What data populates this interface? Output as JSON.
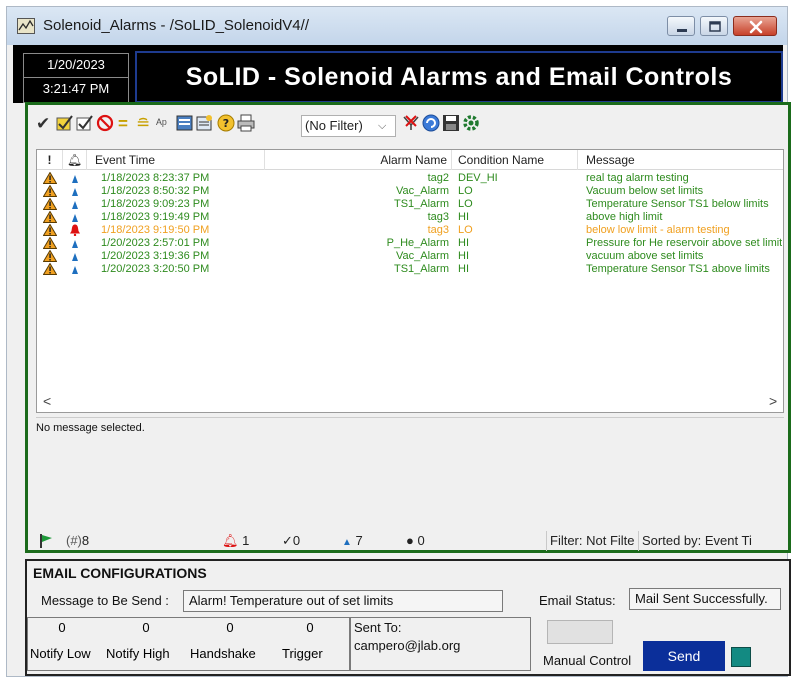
{
  "window": {
    "title": "Solenoid_Alarms - /SoLID_SolenoidV4//"
  },
  "header": {
    "date": "1/20/2023",
    "time": "3:21:47 PM",
    "banner": "SoLID - Solenoid Alarms and Email Controls"
  },
  "toolbar": {
    "filter_value": "(No Filter)",
    "icons": [
      "acknowledge-icon",
      "ack-all-icon",
      "ack-visible-icon",
      "disable-icon",
      "equals-icon",
      "sort-icon",
      "tag-icon",
      "details-icon",
      "settings-icon",
      "help-icon",
      "print-icon",
      "filter-clear-icon",
      "refresh-icon",
      "save-icon",
      "gear-icon"
    ]
  },
  "grid": {
    "columns": [
      "!",
      "",
      "Event Time",
      "Alarm Name",
      "Condition Name",
      "Message"
    ],
    "rows": [
      {
        "time": "1/18/2023 8:23:37 PM",
        "alarm": "tag2",
        "condition": "DEV_HI",
        "message": "real tag alarm testing",
        "state": "normal"
      },
      {
        "time": "1/18/2023 8:50:32 PM",
        "alarm": "Vac_Alarm",
        "condition": "LO",
        "message": "Vacuum below set limits",
        "state": "normal"
      },
      {
        "time": "1/18/2023 9:09:23 PM",
        "alarm": "TS1_Alarm",
        "condition": "LO",
        "message": "Temperature Sensor TS1 below limits",
        "state": "normal"
      },
      {
        "time": "1/18/2023 9:19:49 PM",
        "alarm": "tag3",
        "condition": "HI",
        "message": "above high limit",
        "state": "normal"
      },
      {
        "time": "1/18/2023 9:19:50 PM",
        "alarm": "tag3",
        "condition": "LO",
        "message": "below low limit - alarm testing",
        "state": "active"
      },
      {
        "time": "1/20/2023 2:57:01 PM",
        "alarm": "P_He_Alarm",
        "condition": "HI",
        "message": "Pressure for He reservoir above set limit",
        "state": "normal"
      },
      {
        "time": "1/20/2023 3:19:36 PM",
        "alarm": "Vac_Alarm",
        "condition": "HI",
        "message": "vacuum above set limits",
        "state": "normal"
      },
      {
        "time": "1/20/2023 3:20:50 PM",
        "alarm": "TS1_Alarm",
        "condition": "HI",
        "message": "Temperature Sensor TS1 above limits",
        "state": "normal"
      }
    ],
    "colors": {
      "normal": "#2e8b1e",
      "active": "#f0a020"
    }
  },
  "message_pane": {
    "text": "No message selected."
  },
  "statusbar": {
    "total": "8",
    "active": "1",
    "acked": "0",
    "normal": "7",
    "disabled": "0",
    "filter": "Filter: Not Filte",
    "sorted": "Sorted by: Event Ti"
  },
  "email": {
    "title": "EMAIL CONFIGURATIONS",
    "message_label": "Message to Be Send :",
    "message_value": "Alarm! Temperature out of set limits",
    "status_label": "Email Status:",
    "status_value": "Mail Sent Successfully.",
    "counts": [
      {
        "label": "Notify Low",
        "value": "0"
      },
      {
        "label": "Notify High",
        "value": "0"
      },
      {
        "label": "Handshake",
        "value": "0"
      },
      {
        "label": "Trigger",
        "value": "0"
      }
    ],
    "sent_to_label": "Sent To:",
    "sent_to_value": "campero@jlab.org",
    "manual_control_label": "Manual Control",
    "send_label": "Send"
  }
}
